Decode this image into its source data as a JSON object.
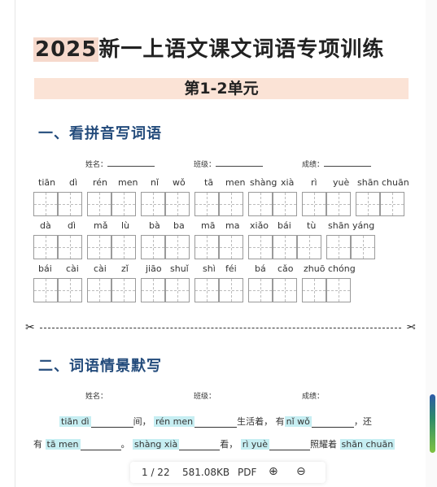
{
  "document": {
    "title_year": "2025",
    "title_rest": "新一上语文课文词语专项训练",
    "unit": "第1-2单元",
    "section1": "一、看拼音写词语",
    "section2": "二、词语情景默写",
    "info": {
      "name": "姓名：",
      "class": "班级：",
      "score": "成绩："
    },
    "pinyin_rows": [
      [
        "tiān",
        "dì",
        "rén",
        "men",
        "nǐ",
        "wǒ",
        "tā",
        "men",
        "shàng",
        "xià",
        "rì",
        "yuè",
        "shān",
        "chuān"
      ],
      [
        "dà",
        "dì",
        "mǎ",
        "lù",
        "bà",
        "ba",
        "mā",
        "ma",
        "xiǎo",
        "bái",
        "tù",
        "shān",
        "yáng"
      ],
      [
        "bái",
        "cài",
        "cài",
        "zǐ",
        "jiāo",
        "shuǐ",
        "shì",
        "féi",
        "bá",
        "cǎo",
        "zhuō",
        "chóng"
      ]
    ],
    "scissors": "✂",
    "fill_line1": {
      "p1": "tiān dì",
      "t1": "间，",
      "p2": "rén men",
      "t2": "生活着，",
      "t3": "有",
      "p3": "nǐ wǒ",
      "t4": "，还"
    },
    "fill_line2": {
      "t1": "有",
      "p1": "tā men",
      "t2": "。",
      "p2": "shàng xià",
      "t3": "看，",
      "p3": "rì yuè",
      "t4": "照耀着",
      "p4": "shān chuān"
    }
  },
  "toolbar": {
    "page": "1 / 22",
    "size": "581.08KB",
    "format": "PDF",
    "zoom_in": "⊕",
    "zoom_out": "⊖"
  }
}
